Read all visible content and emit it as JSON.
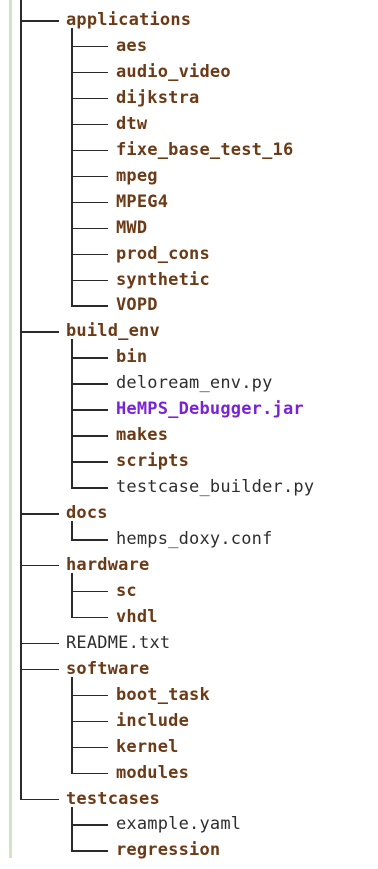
{
  "tree": [
    {
      "name": "applications",
      "kind": "dir",
      "depth": 0
    },
    {
      "name": "aes",
      "kind": "dir",
      "depth": 1
    },
    {
      "name": "audio_video",
      "kind": "dir",
      "depth": 1
    },
    {
      "name": "dijkstra",
      "kind": "dir",
      "depth": 1
    },
    {
      "name": "dtw",
      "kind": "dir",
      "depth": 1
    },
    {
      "name": "fixe_base_test_16",
      "kind": "dir",
      "depth": 1
    },
    {
      "name": "mpeg",
      "kind": "dir",
      "depth": 1
    },
    {
      "name": "MPEG4",
      "kind": "dir",
      "depth": 1
    },
    {
      "name": "MWD",
      "kind": "dir",
      "depth": 1
    },
    {
      "name": "prod_cons",
      "kind": "dir",
      "depth": 1
    },
    {
      "name": "synthetic",
      "kind": "dir",
      "depth": 1
    },
    {
      "name": "VOPD",
      "kind": "dir",
      "depth": 1
    },
    {
      "name": "build_env",
      "kind": "dir",
      "depth": 0
    },
    {
      "name": "bin",
      "kind": "dir",
      "depth": 1
    },
    {
      "name": "deloream_env.py",
      "kind": "file",
      "depth": 1
    },
    {
      "name": "HeMPS_Debugger.jar",
      "kind": "exec",
      "depth": 1
    },
    {
      "name": "makes",
      "kind": "dir",
      "depth": 1
    },
    {
      "name": "scripts",
      "kind": "dir",
      "depth": 1
    },
    {
      "name": "testcase_builder.py",
      "kind": "file",
      "depth": 1
    },
    {
      "name": "docs",
      "kind": "dir",
      "depth": 0
    },
    {
      "name": "hemps_doxy.conf",
      "kind": "file",
      "depth": 1
    },
    {
      "name": "hardware",
      "kind": "dir",
      "depth": 0
    },
    {
      "name": "sc",
      "kind": "dir",
      "depth": 1
    },
    {
      "name": "vhdl",
      "kind": "dir",
      "depth": 1
    },
    {
      "name": "README.txt",
      "kind": "file",
      "depth": 0
    },
    {
      "name": "software",
      "kind": "dir",
      "depth": 0
    },
    {
      "name": "boot_task",
      "kind": "dir",
      "depth": 1
    },
    {
      "name": "include",
      "kind": "dir",
      "depth": 1
    },
    {
      "name": "kernel",
      "kind": "dir",
      "depth": 1
    },
    {
      "name": "modules",
      "kind": "dir",
      "depth": 1
    },
    {
      "name": "testcases",
      "kind": "dir",
      "depth": 0
    },
    {
      "name": "example.yaml",
      "kind": "file",
      "depth": 1
    },
    {
      "name": "regression",
      "kind": "dir",
      "depth": 1
    }
  ],
  "colors": {
    "directory": "#6b3a16",
    "file": "#2d2d2d",
    "executable": "#7a23d6",
    "connector": "#2a2a2a",
    "left_bar": "#cfe6c4",
    "background": "#ffffff"
  }
}
